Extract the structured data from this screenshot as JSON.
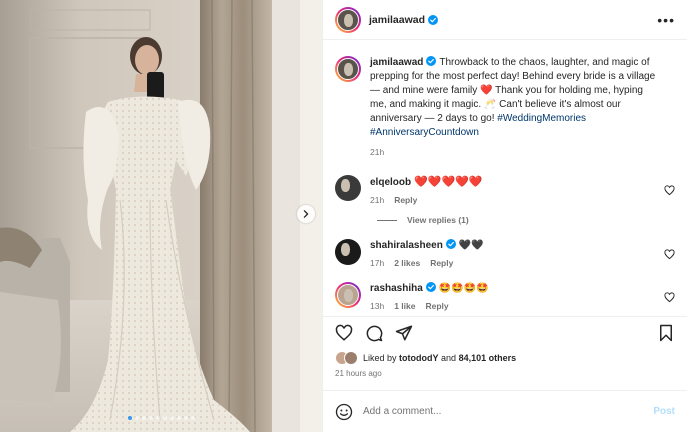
{
  "post": {
    "author": "jamilaawad",
    "caption_text": "Throwback to the chaos, laughter, and magic of prepping for the most perfect day! Behind every bride is a village — and mine were family ❤️ Thank you for holding me, hyping me, and making it magic. 🥂 Can't believe it's almost our anniversary — 2 days to go! ",
    "hashtags": "#WeddingMemories #AnniversaryCountdown",
    "caption_time": "21h",
    "accent_color": "#0095f6",
    "media": {
      "slide_count": 10,
      "active_slide": 1,
      "next_icon": "chevron-right-icon"
    }
  },
  "comments": [
    {
      "user": "elqeloob",
      "text": "❤️❤️❤️❤️❤️",
      "time": "21h",
      "likes": "",
      "reply_label": "Reply",
      "view_replies": "View replies (1)",
      "verified": false
    },
    {
      "user": "shahiralasheen",
      "text": "🖤🖤",
      "time": "17h",
      "likes": "2 likes",
      "reply_label": "Reply",
      "verified": true
    },
    {
      "user": "rashashiha",
      "text": "🤩🤩🤩🤩",
      "time": "13h",
      "likes": "1 like",
      "reply_label": "Reply",
      "verified": true
    }
  ],
  "likes": {
    "prefix": "Liked by ",
    "user": "totododY",
    "middle": " and ",
    "count": "84,101 others"
  },
  "timestamp": "21 hours ago",
  "add_comment": {
    "placeholder": "Add a comment...",
    "post_label": "Post"
  },
  "icons": [
    "verified-badge-icon",
    "more-options-icon",
    "heart-icon",
    "comment-icon",
    "share-icon",
    "bookmark-icon",
    "emoji-icon"
  ]
}
